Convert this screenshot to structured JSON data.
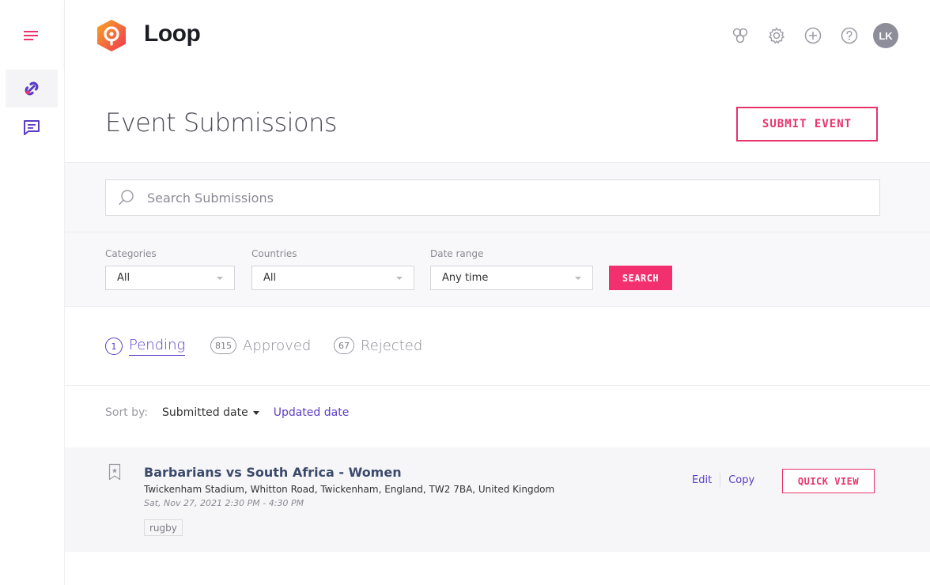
{
  "app": {
    "title": "Loop"
  },
  "header": {
    "avatar_initials": "LK"
  },
  "page": {
    "title": "Event Submissions",
    "submit_label": "SUBMIT EVENT"
  },
  "search": {
    "placeholder": "Search Submissions",
    "value": ""
  },
  "filters": {
    "categories": {
      "label": "Categories",
      "value": "All"
    },
    "countries": {
      "label": "Countries",
      "value": "All"
    },
    "date_range": {
      "label": "Date range",
      "value": "Any time"
    },
    "search_label": "SEARCH"
  },
  "tabs": [
    {
      "count": "1",
      "label": "Pending",
      "active": true
    },
    {
      "count": "815",
      "label": "Approved",
      "active": false
    },
    {
      "count": "67",
      "label": "Rejected",
      "active": false
    }
  ],
  "sort": {
    "label": "Sort by:",
    "current": "Submitted date",
    "alternate": "Updated date"
  },
  "submissions": [
    {
      "title": "Barbarians vs South Africa - Women",
      "address": "Twickenham Stadium, Whitton Road, Twickenham, England, TW2 7BA, United Kingdom",
      "date": "Sat, Nov 27, 2021 2:30 PM - 4:30 PM",
      "tag": "rugby",
      "edit_label": "Edit",
      "copy_label": "Copy",
      "quick_view_label": "QUICK VIEW"
    }
  ],
  "colors": {
    "accent": "#f3306f",
    "link": "#5b3cc4",
    "title_link": "#3b4a6b"
  },
  "icons": {
    "menu": "hamburger-icon",
    "nav_active": "loop-link-icon",
    "nav_messages": "message-icon",
    "header": [
      "integrations-icon",
      "gear-icon",
      "plus-circle-icon",
      "help-icon"
    ],
    "search": "search-icon",
    "bookmark": "bookmark-star-icon"
  }
}
